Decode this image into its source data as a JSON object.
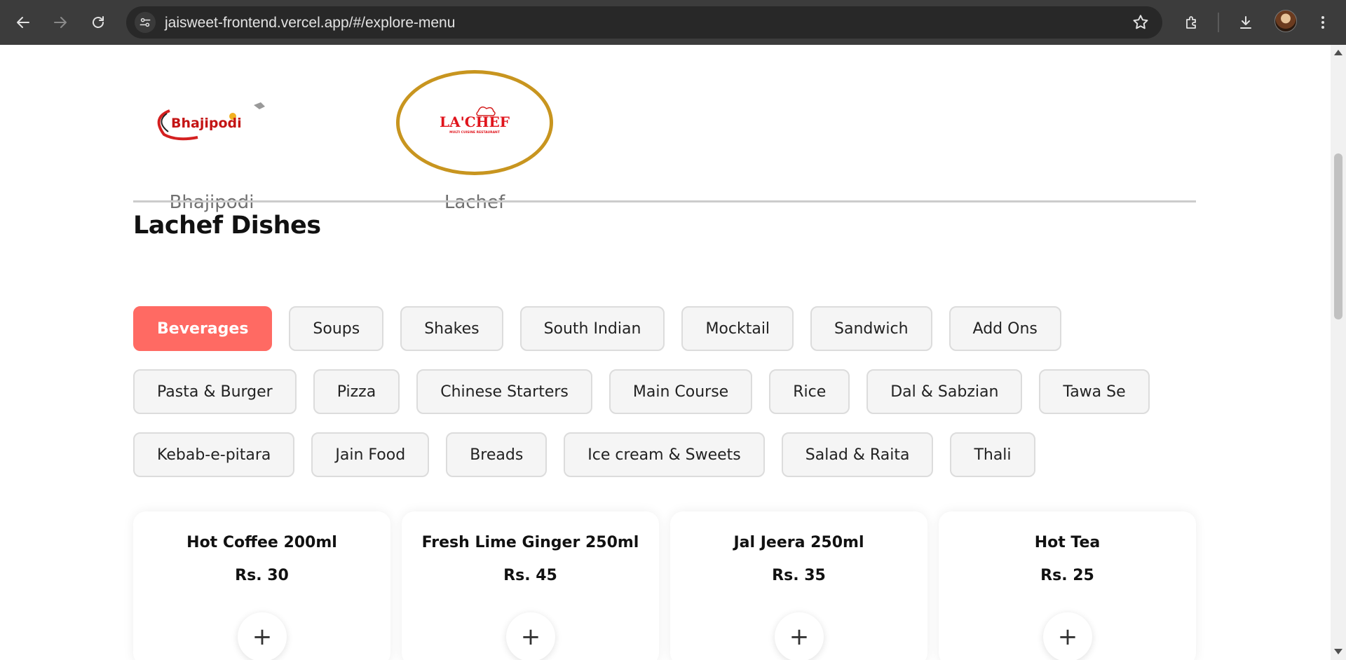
{
  "browser": {
    "url": "jaisweet-frontend.vercel.app/#/explore-menu"
  },
  "restaurants": [
    {
      "name": "Bhajipodi",
      "logo_text": "Bhajipodi",
      "selected": false
    },
    {
      "name": "Lachef",
      "logo_text": "LA'CHEF",
      "logo_subtext": "MULTI CUISINE RESTAURANT",
      "selected": true
    }
  ],
  "section_title": "Lachef Dishes",
  "categories": {
    "row1": [
      "Beverages",
      "Soups",
      "Shakes",
      "South Indian",
      "Mocktail",
      "Sandwich",
      "Add Ons"
    ],
    "row2": [
      "Pasta & Burger",
      "Pizza",
      "Chinese Starters",
      "Main Course",
      "Rice",
      "Dal & Sabzian",
      "Tawa Se"
    ],
    "row3": [
      "Kebab-e-pitara",
      "Jain Food",
      "Breads",
      "Ice cream & Sweets",
      "Salad & Raita",
      "Thali"
    ],
    "active": "Beverages"
  },
  "dishes": [
    {
      "name": "Hot Coffee 200ml",
      "price": "Rs. 30",
      "add_label": "+"
    },
    {
      "name": "Fresh Lime Ginger 250ml",
      "price": "Rs. 45",
      "add_label": "+"
    },
    {
      "name": "Jal Jeera 250ml",
      "price": "Rs. 35",
      "add_label": "+"
    },
    {
      "name": "Hot Tea",
      "price": "Rs. 25",
      "add_label": "+"
    }
  ],
  "colors": {
    "accent": "#ff6a63",
    "selected_ring": "#c8951f",
    "chrome_bg": "#3c3c3c"
  }
}
